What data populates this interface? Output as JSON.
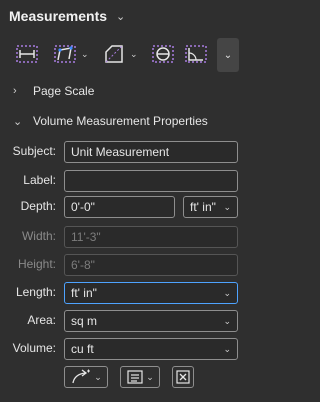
{
  "panel": {
    "title": "Measurements"
  },
  "toolbar": {
    "tools": [
      {
        "name": "length-tool-icon"
      },
      {
        "name": "polylength-tool-icon"
      },
      {
        "name": "area-tool-icon"
      },
      {
        "name": "perimeter-tool-icon"
      },
      {
        "name": "angle-tool-icon"
      }
    ]
  },
  "sections": {
    "page_scale": "Page Scale",
    "volume_props": "Volume Measurement Properties"
  },
  "form": {
    "subject": {
      "label": "Subject:",
      "value": "Unit Measurement"
    },
    "label": {
      "label": "Label:",
      "value": ""
    },
    "depth": {
      "label": "Depth:",
      "value": "0'-0\"",
      "unit": "ft' in\""
    },
    "width": {
      "label": "Width:",
      "value": "11'-3\""
    },
    "height": {
      "label": "Height:",
      "value": "6'-8\""
    },
    "length": {
      "label": "Length:",
      "value": "ft' in\""
    },
    "area": {
      "label": "Area:",
      "value": "sq m"
    },
    "volume": {
      "label": "Volume:",
      "value": "cu ft"
    }
  },
  "colors": {
    "accent": "#4ea3ff",
    "panel_bg": "#2f2f2f",
    "icon_blue": "#3d8bff",
    "icon_purple": "#a97de0"
  }
}
